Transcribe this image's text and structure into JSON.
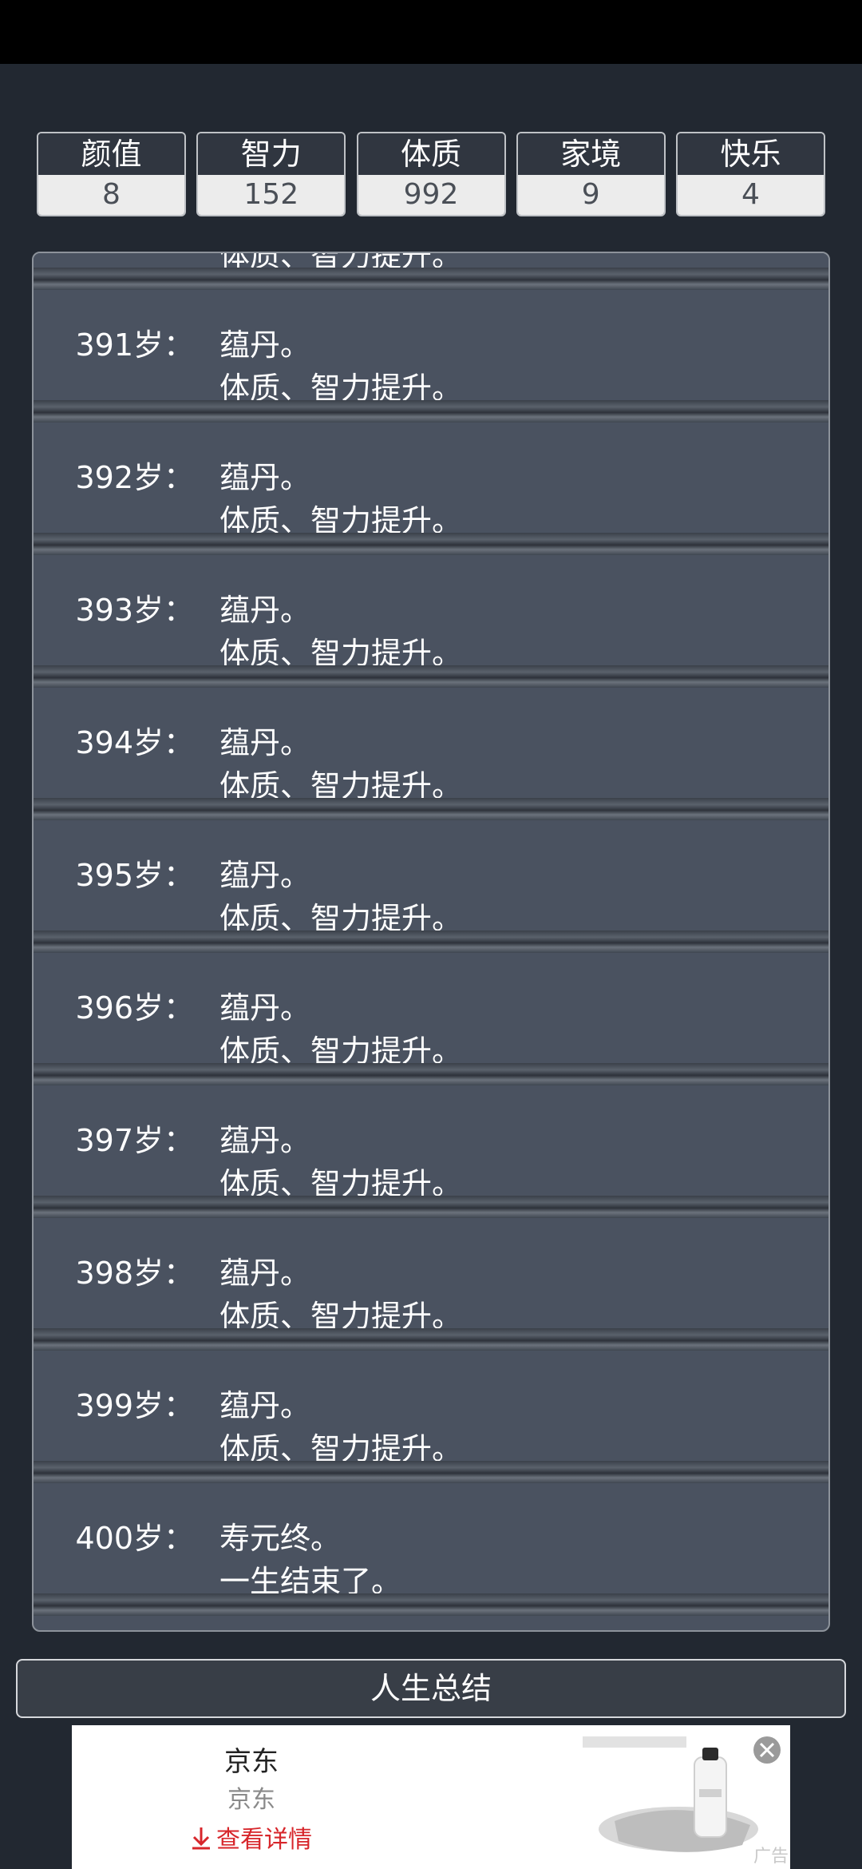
{
  "stats": [
    {
      "label": "颜值",
      "value": "8"
    },
    {
      "label": "智力",
      "value": "152"
    },
    {
      "label": "体质",
      "value": "992"
    },
    {
      "label": "家境",
      "value": "9"
    },
    {
      "label": "快乐",
      "value": "4"
    }
  ],
  "log": {
    "partial_line": "体质、智力提升。",
    "entries": [
      {
        "age": "391岁：",
        "line1": "蕴丹。",
        "line2": "体质、智力提升。"
      },
      {
        "age": "392岁：",
        "line1": "蕴丹。",
        "line2": "体质、智力提升。"
      },
      {
        "age": "393岁：",
        "line1": "蕴丹。",
        "line2": "体质、智力提升。"
      },
      {
        "age": "394岁：",
        "line1": "蕴丹。",
        "line2": "体质、智力提升。"
      },
      {
        "age": "395岁：",
        "line1": "蕴丹。",
        "line2": "体质、智力提升。"
      },
      {
        "age": "396岁：",
        "line1": "蕴丹。",
        "line2": "体质、智力提升。"
      },
      {
        "age": "397岁：",
        "line1": "蕴丹。",
        "line2": "体质、智力提升。"
      },
      {
        "age": "398岁：",
        "line1": "蕴丹。",
        "line2": "体质、智力提升。"
      },
      {
        "age": "399岁：",
        "line1": "蕴丹。",
        "line2": "体质、智力提升。"
      },
      {
        "age": "400岁：",
        "line1": "寿元终。",
        "line2": "一生结束了。"
      }
    ]
  },
  "summary_button": "人生总结",
  "ad": {
    "title": "京东",
    "subtitle": "京东",
    "cta": "查看详情",
    "tag": "广告",
    "close_icon": "close-icon",
    "cta_icon": "download-icon",
    "accent": "#d7262b"
  }
}
